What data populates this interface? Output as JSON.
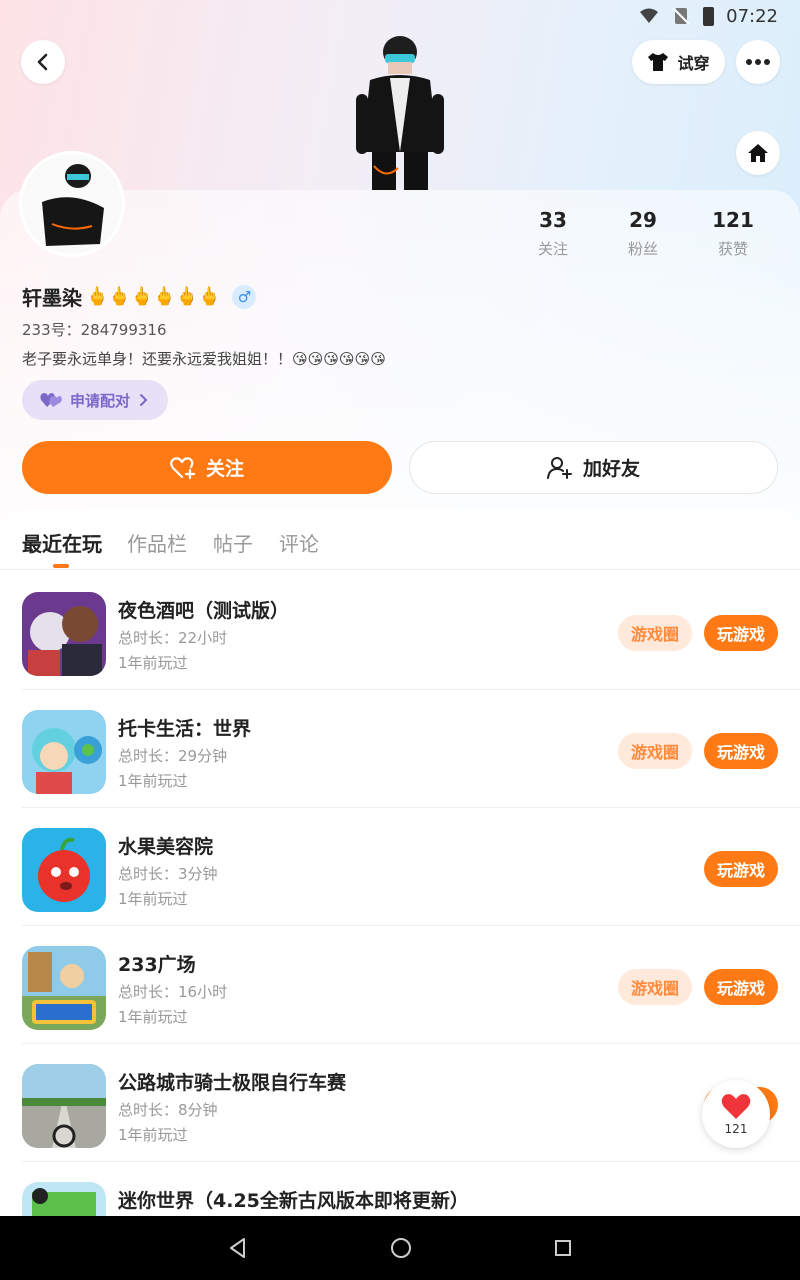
{
  "status_bar": {
    "time": "07:22"
  },
  "header": {
    "try_on_label": "试穿"
  },
  "profile": {
    "username": "轩墨染",
    "username_emoji": "🖕🖕🖕🖕🖕🖕",
    "gender_symbol": "♂",
    "uid": "233号：284799316",
    "bio": "老子要永远单身！还要永远爱我姐姐！！😘😘😘😘😘😘",
    "pair_label": "申请配对"
  },
  "stats": [
    {
      "value": "33",
      "label": "关注"
    },
    {
      "value": "29",
      "label": "粉丝"
    },
    {
      "value": "121",
      "label": "获赞"
    }
  ],
  "actions": {
    "follow_label": "关注",
    "add_friend_label": "加好友"
  },
  "tabs": [
    {
      "label": "最近在玩"
    },
    {
      "label": "作品栏"
    },
    {
      "label": "帖子"
    },
    {
      "label": "评论"
    }
  ],
  "games": [
    {
      "name": "夜色酒吧（测试版）",
      "duration": "总时长：22小时",
      "last_played": "1年前玩过",
      "circle_label": "游戏圈",
      "play_label": "玩游戏"
    },
    {
      "name": "托卡生活：世界",
      "duration": "总时长：29分钟",
      "last_played": "1年前玩过",
      "circle_label": "游戏圈",
      "play_label": "玩游戏"
    },
    {
      "name": "水果美容院",
      "duration": "总时长：3分钟",
      "last_played": "1年前玩过",
      "play_label": "玩游戏"
    },
    {
      "name": "233广场",
      "duration": "总时长：16小时",
      "last_played": "1年前玩过",
      "circle_label": "游戏圈",
      "play_label": "玩游戏"
    },
    {
      "name": "公路城市骑士极限自行车赛",
      "duration": "总时长：8分钟",
      "last_played": "1年前玩过",
      "play_label": "玩游戏"
    },
    {
      "name": "迷你世界（4.25全新古风版本即将更新）"
    }
  ],
  "floating_like": {
    "count": "121"
  },
  "colors": {
    "accent": "#ff7a14",
    "accent_light": "#ffe9db",
    "pair_bg": "#e6e1f7",
    "pair_text": "#7b68c9"
  }
}
